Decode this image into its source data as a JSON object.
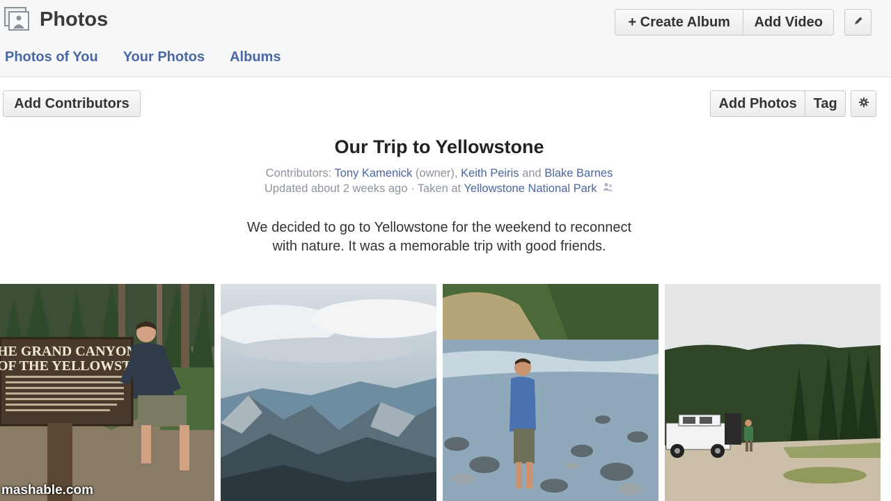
{
  "header": {
    "title": "Photos",
    "create_album": "+ Create Album",
    "add_video": "Add Video",
    "edit_icon": "pencil-icon",
    "tabs": [
      {
        "label": "Photos of You"
      },
      {
        "label": "Your Photos"
      },
      {
        "label": "Albums"
      }
    ]
  },
  "toolbar": {
    "add_contributors": "Add Contributors",
    "add_photos": "Add Photos",
    "tag": "Tag",
    "settings_icon": "gear-icon"
  },
  "album": {
    "title": "Our Trip to Yellowstone",
    "contributors_prefix": "Contributors:",
    "contributor_1": "Tony Kamenick",
    "owner_note": "(owner),",
    "contributor_2": "Keith Peiris",
    "and": "and",
    "contributor_3": "Blake Barnes",
    "updated": "Updated about 2 weeks ago · Taken at",
    "location": "Yellowstone National Park",
    "description_line1": "We decided to go to Yellowstone for the weekend to reconnect",
    "description_line2": "with nature. It was a memorable trip with good friends."
  },
  "photos": [
    {
      "sign_line1": "HE GRAND CANYON",
      "sign_line2": "OF THE YELLOWSTONE"
    },
    {},
    {},
    {}
  ],
  "watermark": "mashable.com",
  "colors": {
    "link": "#4b67a1",
    "header_bg": "#f6f7f9"
  }
}
